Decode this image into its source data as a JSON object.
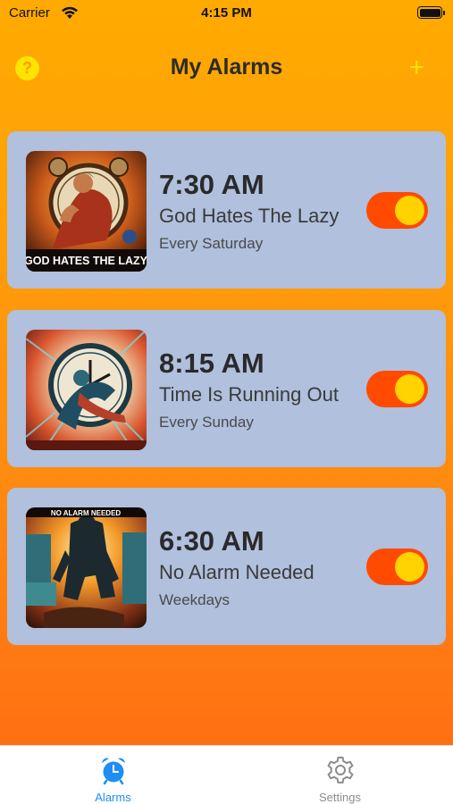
{
  "status_bar": {
    "carrier": "Carrier",
    "time": "4:15 PM"
  },
  "nav": {
    "title": "My Alarms",
    "help_icon": "?",
    "add_icon": "+"
  },
  "alarms": [
    {
      "time": "7:30 AM",
      "name": "God Hates The Lazy",
      "repeat": "Every Saturday",
      "enabled": true,
      "image_caption": "GOD HATES THE LAZY"
    },
    {
      "time": "8:15 AM",
      "name": "Time Is Running Out",
      "repeat": "Every Sunday",
      "enabled": true,
      "image_caption": ""
    },
    {
      "time": "6:30 AM",
      "name": "No Alarm Needed",
      "repeat": "Weekdays",
      "enabled": true,
      "image_caption": "NO ALARM NEEDED"
    }
  ],
  "tabs": [
    {
      "label": "Alarms",
      "icon": "alarm-clock-icon",
      "selected": true
    },
    {
      "label": "Settings",
      "icon": "gear-icon",
      "selected": false
    }
  ],
  "colors": {
    "accent": "#1E8EF5",
    "card": "#B0C0DD",
    "toggle_on": "#FF4A00",
    "toggle_knob": "#FFD200",
    "header_icon": "#FFE400"
  }
}
